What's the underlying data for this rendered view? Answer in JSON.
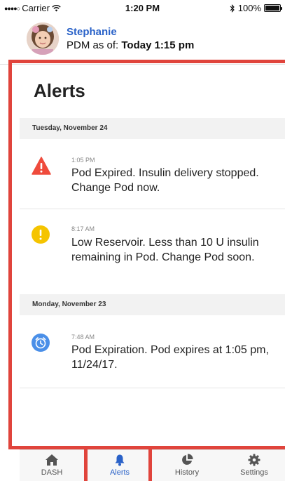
{
  "status_bar": {
    "carrier": "Carrier",
    "time": "1:20 PM",
    "battery": "100%"
  },
  "header": {
    "name": "Stephanie",
    "pdm_label": "PDM as of:",
    "pdm_value": "Today 1:15 pm"
  },
  "page": {
    "title": "Alerts"
  },
  "sections": [
    {
      "date": "Tuesday, November 24",
      "alerts": [
        {
          "time": "1:05 PM",
          "icon": "warning-triangle-icon",
          "color": "#ef4b3c",
          "message": "Pod Expired. Insulin delivery stopped. Change Pod now."
        },
        {
          "time": "8:17 AM",
          "icon": "exclamation-circle-icon",
          "color": "#f5c400",
          "message": "Low Reservoir. Less than 10 U insulin remaining in Pod. Change Pod soon."
        }
      ]
    },
    {
      "date": "Monday, November 23",
      "alerts": [
        {
          "time": "7:48 AM",
          "icon": "alarm-clock-icon",
          "color": "#4a8fe8",
          "message": "Pod Expiration. Pod expires at 1:05 pm, 11/24/17."
        }
      ]
    }
  ],
  "tabbar": {
    "tabs": [
      {
        "label": "DASH",
        "icon": "home-icon"
      },
      {
        "label": "Alerts",
        "icon": "bell-icon",
        "active": true
      },
      {
        "label": "History",
        "icon": "pie-chart-icon"
      },
      {
        "label": "Settings",
        "icon": "gear-icon"
      }
    ]
  },
  "colors": {
    "accent": "#2a62c8",
    "highlight_frame": "#e0443c"
  }
}
